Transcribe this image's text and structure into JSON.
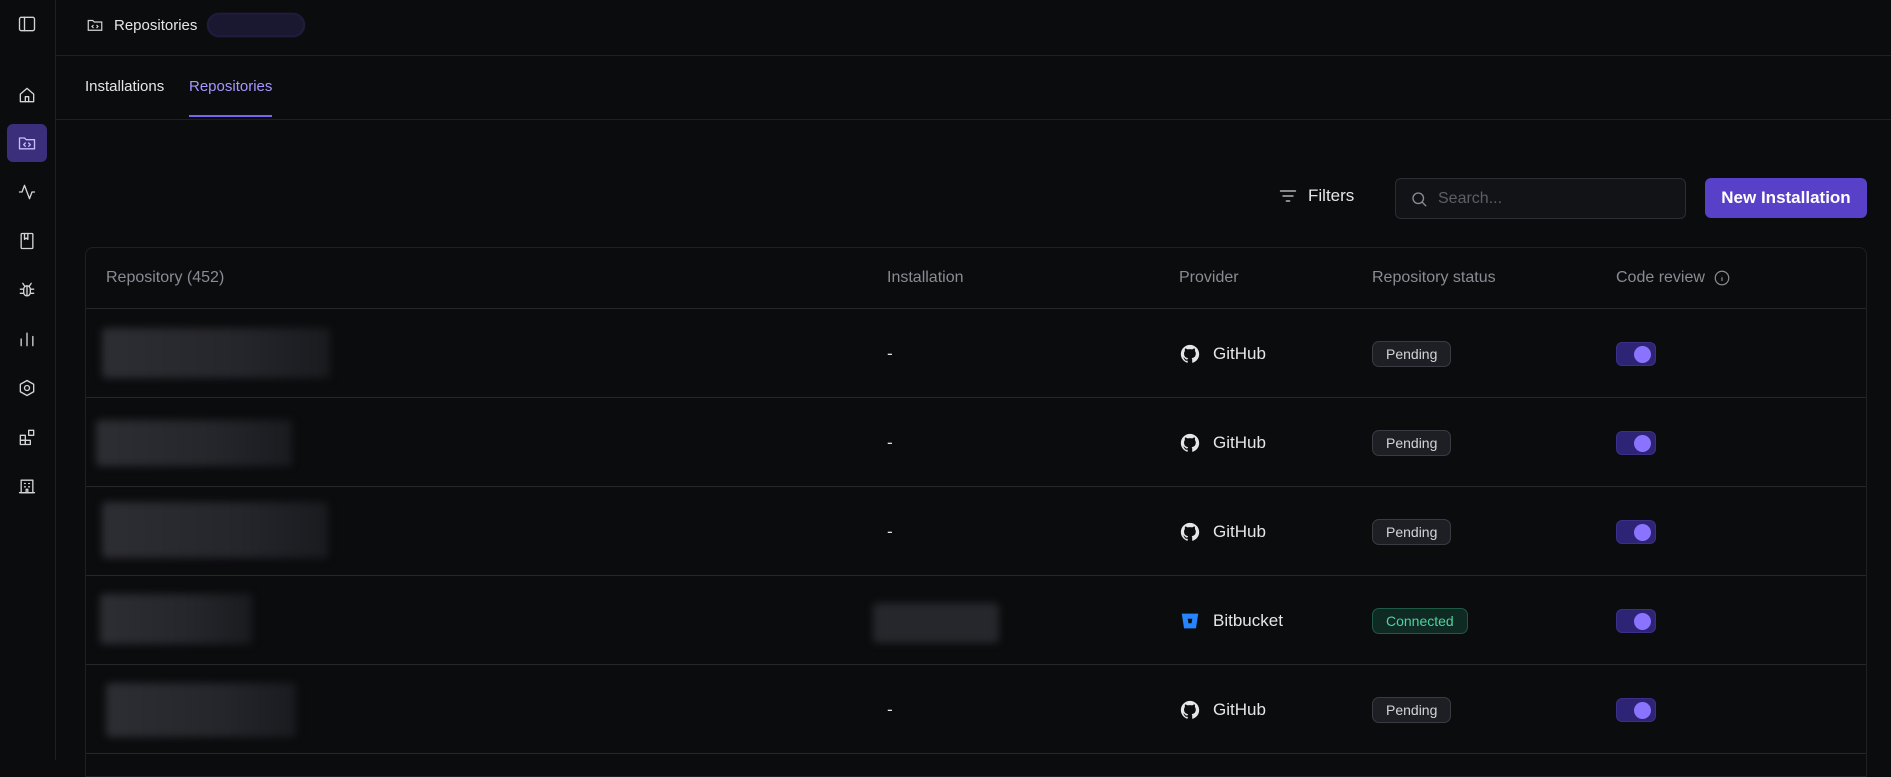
{
  "breadcrumb": {
    "label": "Repositories"
  },
  "tabs": [
    {
      "label": "Installations",
      "active": false
    },
    {
      "label": "Repositories",
      "active": true
    }
  ],
  "toolbar": {
    "filters_label": "Filters",
    "search_placeholder": "Search...",
    "new_button_label": "New Installation"
  },
  "table": {
    "headers": {
      "repository": "Repository (452)",
      "installation": "Installation",
      "provider": "Provider",
      "status": "Repository status",
      "code_review": "Code review"
    },
    "rows": [
      {
        "installation": "-",
        "provider": "GitHub",
        "provider_icon": "github-icon",
        "status": "Pending",
        "code_review": true
      },
      {
        "installation": "-",
        "provider": "GitHub",
        "provider_icon": "github-icon",
        "status": "Pending",
        "code_review": true
      },
      {
        "installation": "-",
        "provider": "GitHub",
        "provider_icon": "github-icon",
        "status": "Pending",
        "code_review": true
      },
      {
        "installation": "",
        "provider": "Bitbucket",
        "provider_icon": "bitbucket-icon",
        "status": "Connected",
        "code_review": true
      },
      {
        "installation": "-",
        "provider": "GitHub",
        "provider_icon": "github-icon",
        "status": "Pending",
        "code_review": true
      }
    ]
  },
  "colors": {
    "accent": "#5940c9",
    "accent_text": "#a895ff",
    "connected": "#4fd1a0",
    "background": "#0b0c0e"
  }
}
